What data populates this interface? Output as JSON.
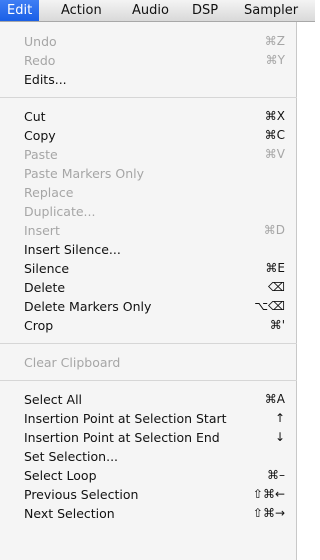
{
  "menubar": {
    "items": [
      "Edit",
      "Action",
      "Audio",
      "DSP",
      "Sampler"
    ],
    "active_index": 0
  },
  "edit_menu": {
    "groups": [
      [
        {
          "label": "Undo",
          "shortcut": "⌘Z",
          "enabled": false
        },
        {
          "label": "Redo",
          "shortcut": "⌘Y",
          "enabled": false
        },
        {
          "label": "Edits...",
          "shortcut": "",
          "enabled": true
        }
      ],
      [
        {
          "label": "Cut",
          "shortcut": "⌘X",
          "enabled": true
        },
        {
          "label": "Copy",
          "shortcut": "⌘C",
          "enabled": true
        },
        {
          "label": "Paste",
          "shortcut": "⌘V",
          "enabled": false
        },
        {
          "label": "Paste Markers Only",
          "shortcut": "",
          "enabled": false
        },
        {
          "label": "Replace",
          "shortcut": "",
          "enabled": false
        },
        {
          "label": "Duplicate...",
          "shortcut": "",
          "enabled": false
        },
        {
          "label": "Insert",
          "shortcut": "⌘D",
          "enabled": false
        },
        {
          "label": "Insert Silence...",
          "shortcut": "",
          "enabled": true
        },
        {
          "label": "Silence",
          "shortcut": "⌘E",
          "enabled": true
        },
        {
          "label": "Delete",
          "shortcut": "⌫",
          "enabled": true
        },
        {
          "label": "Delete Markers Only",
          "shortcut": "⌥⌫",
          "enabled": true
        },
        {
          "label": "Crop",
          "shortcut": "⌘'",
          "enabled": true
        }
      ],
      [
        {
          "label": "Clear Clipboard",
          "shortcut": "",
          "enabled": false
        }
      ],
      [
        {
          "label": "Select All",
          "shortcut": "⌘A",
          "enabled": true
        },
        {
          "label": "Insertion Point at Selection Start",
          "shortcut": "↑",
          "enabled": true
        },
        {
          "label": "Insertion Point at Selection End",
          "shortcut": "↓",
          "enabled": true
        },
        {
          "label": "Set Selection...",
          "shortcut": "",
          "enabled": true
        },
        {
          "label": "Select Loop",
          "shortcut": "⌘–",
          "enabled": true
        },
        {
          "label": "Previous Selection",
          "shortcut": "⇧⌘←",
          "enabled": true
        },
        {
          "label": "Next Selection",
          "shortcut": "⇧⌘→",
          "enabled": true
        }
      ]
    ]
  }
}
